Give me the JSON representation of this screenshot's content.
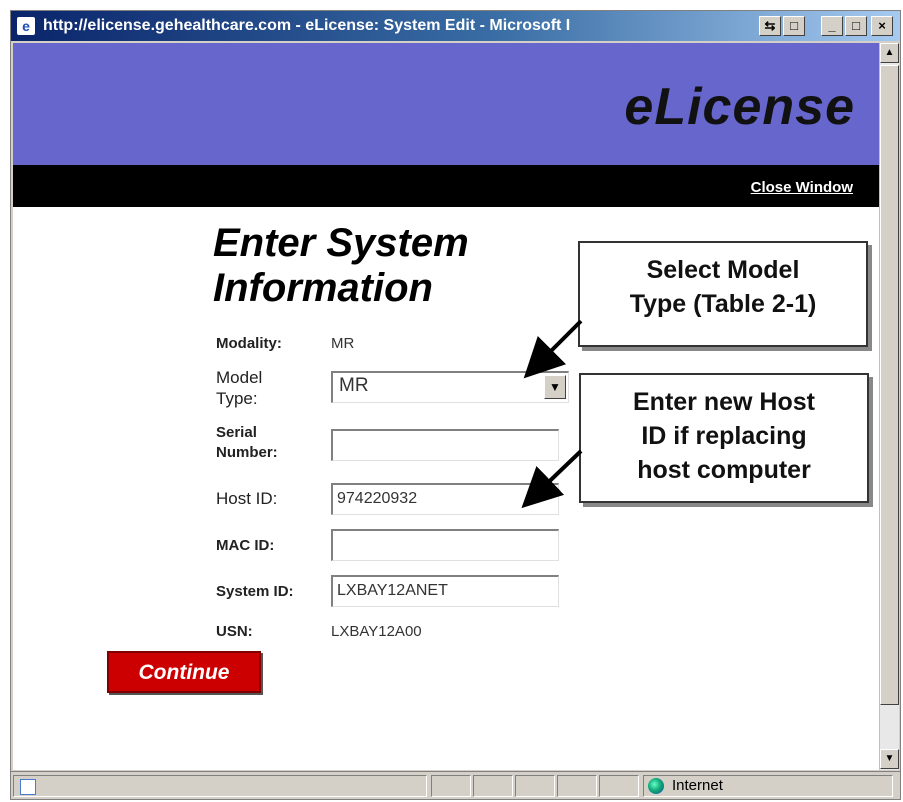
{
  "window": {
    "title": "http://elicense.gehealthcare.com - eLicense: System Edit - Microsoft I",
    "controls": [
      "⇆",
      "□",
      "_",
      "□",
      "×"
    ]
  },
  "header": {
    "brand": "eLicense",
    "close_link": "Close Window"
  },
  "form": {
    "heading_line1": "Enter System",
    "heading_line2": "Information",
    "modality_label": "Modality:",
    "modality_value": "MR",
    "model_type_label_line1": "Model",
    "model_type_label_line2": "Type:",
    "model_type_value": "MR",
    "serial_label_line1": "Serial",
    "serial_label_line2": "Number:",
    "serial_value": "",
    "host_id_label": "Host ID:",
    "host_id_value": "974220932",
    "mac_id_label": "MAC ID:",
    "mac_id_value": "",
    "system_id_label": "System ID:",
    "system_id_value": "LXBAY12ANET",
    "usn_label": "USN:",
    "usn_value": "LXBAY12A00",
    "continue_label": "Continue"
  },
  "callouts": {
    "model": [
      "Select Model",
      "Type (Table 2-1)"
    ],
    "host": [
      "Enter new Host",
      "ID if replacing",
      "host computer"
    ]
  },
  "status": {
    "zone": "Internet"
  }
}
